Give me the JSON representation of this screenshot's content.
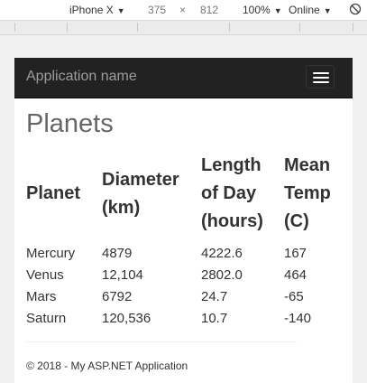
{
  "devtools": {
    "device": "iPhone X",
    "width": "375",
    "times": "×",
    "height": "812",
    "zoom": "100%",
    "network": "Online",
    "caret": "▼"
  },
  "navbar": {
    "brand": "Application name"
  },
  "page": {
    "title": "Planets"
  },
  "table": {
    "headers": [
      "Planet",
      "Diameter (km)",
      "Length of Day (hours)",
      "Mean Temp (C)"
    ],
    "rows": [
      [
        "Mercury",
        "4879",
        "4222.6",
        "167"
      ],
      [
        "Venus",
        "12,104",
        "2802.0",
        "464"
      ],
      [
        "Mars",
        "6792",
        "24.7",
        "-65"
      ],
      [
        "Saturn",
        "120,536",
        "10.7",
        "-140"
      ]
    ]
  },
  "footer": {
    "text": "© 2018 - My ASP.NET Application"
  },
  "colors": {
    "navbar_bg": "#222222",
    "brand_text": "#9d9d9d",
    "title_text": "#666666"
  },
  "icons": [
    "rotate-icon",
    "hamburger-menu-icon"
  ]
}
